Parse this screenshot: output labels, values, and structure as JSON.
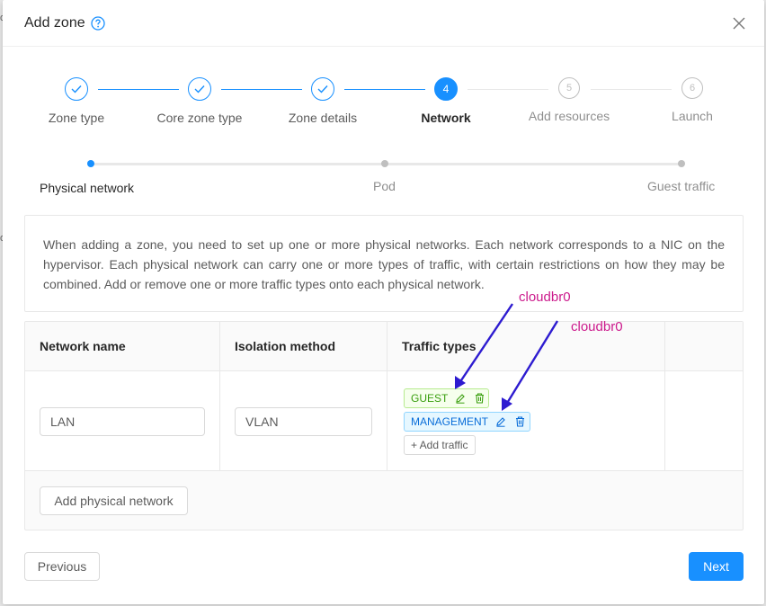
{
  "colors": {
    "primary": "#1890ff",
    "guest_tag": "#389e0d",
    "management_tag": "#096dd9",
    "annotation_text": "#cc1a8c",
    "annotation_arrow": "#2d1bd0"
  },
  "modal": {
    "title": "Add zone",
    "help_icon": "question-circle-icon",
    "close_icon": "close-icon"
  },
  "steps": [
    {
      "number": "1",
      "label": "Zone type",
      "status": "done"
    },
    {
      "number": "2",
      "label": "Core zone type",
      "status": "done"
    },
    {
      "number": "3",
      "label": "Zone details",
      "status": "done"
    },
    {
      "number": "4",
      "label": "Network",
      "status": "active"
    },
    {
      "number": "5",
      "label": "Add resources",
      "status": "wait"
    },
    {
      "number": "6",
      "label": "Launch",
      "status": "wait"
    }
  ],
  "substeps": [
    {
      "label": "Physical network",
      "status": "active"
    },
    {
      "label": "Pod",
      "status": "wait"
    },
    {
      "label": "Guest traffic",
      "status": "wait"
    }
  ],
  "info_text": "When adding a zone, you need to set up one or more physical networks. Each network corresponds to a NIC on the hypervisor. Each physical network can carry one or more types of traffic, with certain restrictions on how they may be combined. Add or remove one or more traffic types onto each physical network.",
  "table": {
    "headers": [
      "Network name",
      "Isolation method",
      "Traffic types",
      ""
    ],
    "rows": [
      {
        "network_name": "LAN",
        "isolation_method": "VLAN",
        "traffic_types": [
          "GUEST",
          "MANAGEMENT"
        ],
        "add_traffic_label": "+ Add traffic"
      }
    ]
  },
  "add_physical_network_label": "Add physical network",
  "annotations": [
    "cloudbr0",
    "cloudbr0"
  ],
  "footer": {
    "previous_label": "Previous",
    "next_label": "Next"
  }
}
